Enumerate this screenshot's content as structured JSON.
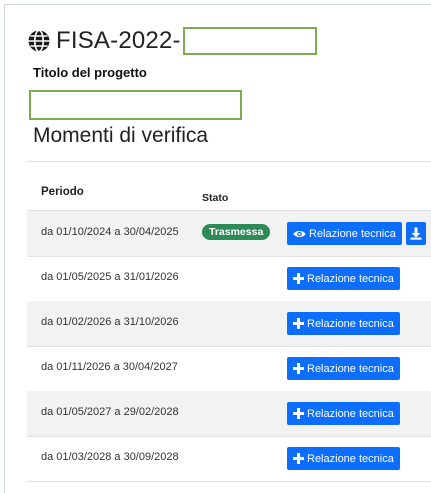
{
  "header": {
    "icon": "globe-icon",
    "title_prefix": "FISA-2022-",
    "subtitle": "Titolo del progetto",
    "section_title": "Momenti di verifica"
  },
  "table": {
    "headers": {
      "period": "Periodo",
      "state": "Stato"
    },
    "rows": [
      {
        "period": "da 01/10/2024 a 30/04/2025",
        "state": "Trasmessa",
        "action": "Relazione tecnica",
        "action_icon": "eye-icon",
        "download_icon": "download-icon"
      },
      {
        "period": "da 01/05/2025 a 31/01/2026",
        "state": "",
        "action": "Relazione tecnica",
        "action_icon": "plus-icon"
      },
      {
        "period": "da 01/02/2026 a 31/10/2026",
        "state": "",
        "action": "Relazione tecnica",
        "action_icon": "plus-icon"
      },
      {
        "period": "da 01/11/2026 a 30/04/2027",
        "state": "",
        "action": "Relazione tecnica",
        "action_icon": "plus-icon"
      },
      {
        "period": "da 01/05/2027 a 29/02/2028",
        "state": "",
        "action": "Relazione tecnica",
        "action_icon": "plus-icon"
      },
      {
        "period": "da 01/03/2028 a 30/09/2028",
        "state": "",
        "action": "Relazione tecnica",
        "action_icon": "plus-icon"
      }
    ]
  },
  "colors": {
    "primary": "#0d6efd",
    "success": "#2e8b57",
    "highlight": "#7dab4f"
  }
}
